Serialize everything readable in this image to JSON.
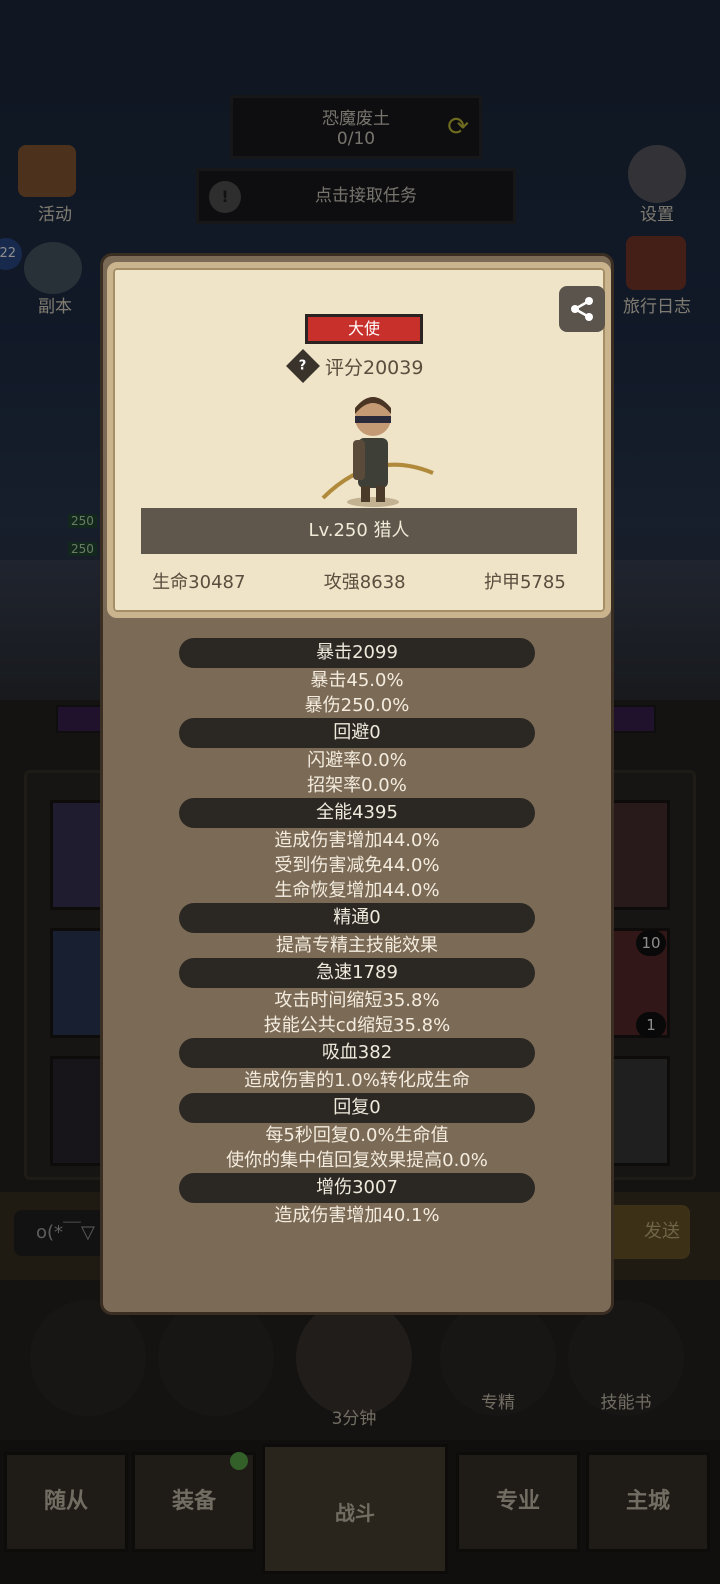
{
  "hud": {
    "zone_name": "恐魔废土",
    "zone_progress": "0/10",
    "quest_label": "点击接取任务",
    "activity_label": "活动",
    "dungeon_label": "副本",
    "dungeon_badge": "22",
    "settings_label": "设置",
    "journal_label": "旅行日志"
  },
  "background": {
    "level_tags": [
      "250",
      "250"
    ],
    "slot_counts": [
      "10",
      "1"
    ],
    "chat_placeholder": "o(*￣▽",
    "send_label": "发送",
    "timer_label": "3分钟",
    "tools": [
      {
        "label": "",
        "icon": "potion-icon"
      },
      {
        "label": "",
        "icon": "bread-icon"
      },
      {
        "label": "3分钟",
        "icon": "chest-icon"
      },
      {
        "label": "专精",
        "icon": "specialization-icon"
      },
      {
        "label": "技能书",
        "icon": "skill-book-icon"
      }
    ]
  },
  "nav": {
    "tabs": [
      {
        "label": "随从"
      },
      {
        "label": "装备"
      },
      {
        "label": "战斗"
      },
      {
        "label": "专业"
      },
      {
        "label": "主城"
      }
    ]
  },
  "card": {
    "rank": "大使",
    "score": "评分20039",
    "level_class": "Lv.250 猎人",
    "stats": {
      "hp": "生命30487",
      "attack": "攻强8638",
      "armor": "护甲5785"
    }
  },
  "attributes": [
    {
      "title": "暴击2099",
      "lines": [
        "暴击45.0%",
        "暴伤250.0%"
      ]
    },
    {
      "title": "回避0",
      "lines": [
        "闪避率0.0%",
        "招架率0.0%"
      ]
    },
    {
      "title": "全能4395",
      "lines": [
        "造成伤害增加44.0%",
        "受到伤害减免44.0%",
        "生命恢复增加44.0%"
      ]
    },
    {
      "title": "精通0",
      "lines": [
        "提高专精主技能效果"
      ]
    },
    {
      "title": "急速1789",
      "lines": [
        "攻击时间缩短35.8%",
        "技能公共cd缩短35.8%"
      ]
    },
    {
      "title": "吸血382",
      "lines": [
        "造成伤害的1.0%转化成生命"
      ]
    },
    {
      "title": "回复0",
      "lines": [
        "每5秒回复0.0%生命值",
        "使你的集中值回复效果提高0.0%"
      ]
    },
    {
      "title": "增伤3007",
      "lines": [
        "造成伤害增加40.1%"
      ]
    }
  ],
  "colors": {
    "rank_badge": "#c8302c",
    "dialog_bg": "#7b6a55",
    "card_bg": "#efe3c8",
    "pill_bg": "#2b2824"
  }
}
